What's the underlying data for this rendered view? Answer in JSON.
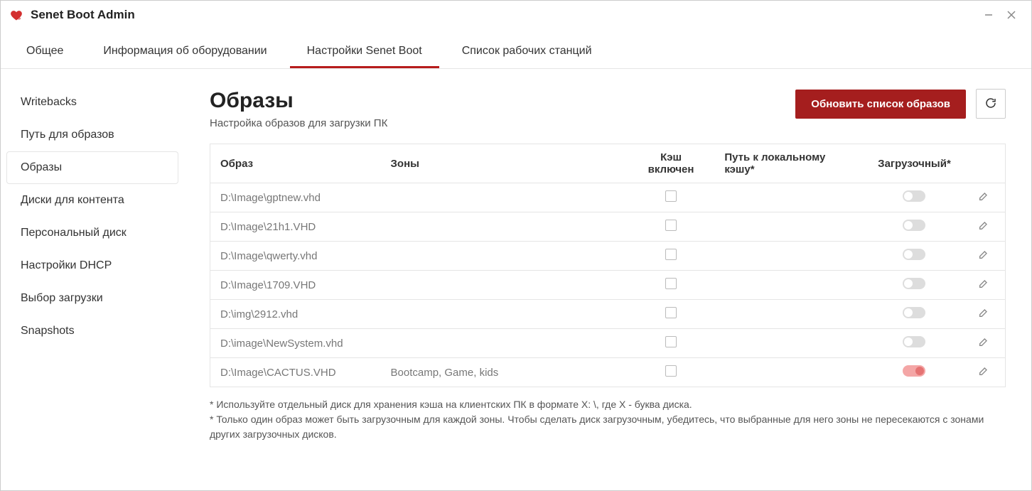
{
  "window": {
    "title": "Senet Boot Admin"
  },
  "tabs": [
    {
      "label": "Общее",
      "active": false
    },
    {
      "label": "Информация об оборудовании",
      "active": false
    },
    {
      "label": "Настройки Senet Boot",
      "active": true
    },
    {
      "label": "Список рабочих станций",
      "active": false
    }
  ],
  "sidebar": [
    {
      "label": "Writebacks",
      "active": false
    },
    {
      "label": "Путь для образов",
      "active": false
    },
    {
      "label": "Образы",
      "active": true
    },
    {
      "label": "Диски для контента",
      "active": false
    },
    {
      "label": "Персональный диск",
      "active": false
    },
    {
      "label": "Настройки DHCP",
      "active": false
    },
    {
      "label": "Выбор загрузки",
      "active": false
    },
    {
      "label": "Snapshots",
      "active": false
    }
  ],
  "page": {
    "title": "Образы",
    "subtitle": "Настройка образов для загрузки ПК",
    "update_button": "Обновить список образов"
  },
  "table": {
    "headers": {
      "image": "Образ",
      "zones": "Зоны",
      "cache_enabled": "Кэш включен",
      "cache_path": "Путь к локальному кэшу*",
      "bootable": "Загрузочный*"
    },
    "rows": [
      {
        "image": "D:\\Image\\gptnew.vhd",
        "zones": "",
        "cache_enabled": false,
        "cache_path": "",
        "bootable": false
      },
      {
        "image": "D:\\Image\\21h1.VHD",
        "zones": "",
        "cache_enabled": false,
        "cache_path": "",
        "bootable": false
      },
      {
        "image": "D:\\Image\\qwerty.vhd",
        "zones": "",
        "cache_enabled": false,
        "cache_path": "",
        "bootable": false
      },
      {
        "image": "D:\\Image\\1709.VHD",
        "zones": "",
        "cache_enabled": false,
        "cache_path": "",
        "bootable": false
      },
      {
        "image": "D:\\img\\2912.vhd",
        "zones": "",
        "cache_enabled": false,
        "cache_path": "",
        "bootable": false
      },
      {
        "image": "D:\\image\\NewSystem.vhd",
        "zones": "",
        "cache_enabled": false,
        "cache_path": "",
        "bootable": false
      },
      {
        "image": "D:\\Image\\CACTUS.VHD",
        "zones": "Bootcamp, Game, kids",
        "cache_enabled": false,
        "cache_path": "",
        "bootable": true
      }
    ]
  },
  "footnotes": {
    "note1": "* Используйте отдельный диск для хранения кэша на клиентских ПК в формате X: \\, где X - буква диска.",
    "note2": "* Только один образ может быть загрузочным для каждой зоны. Чтобы сделать диск загрузочным, убедитесь, что выбранные для него зоны не пересекаются с зонами других загрузочных дисков."
  }
}
